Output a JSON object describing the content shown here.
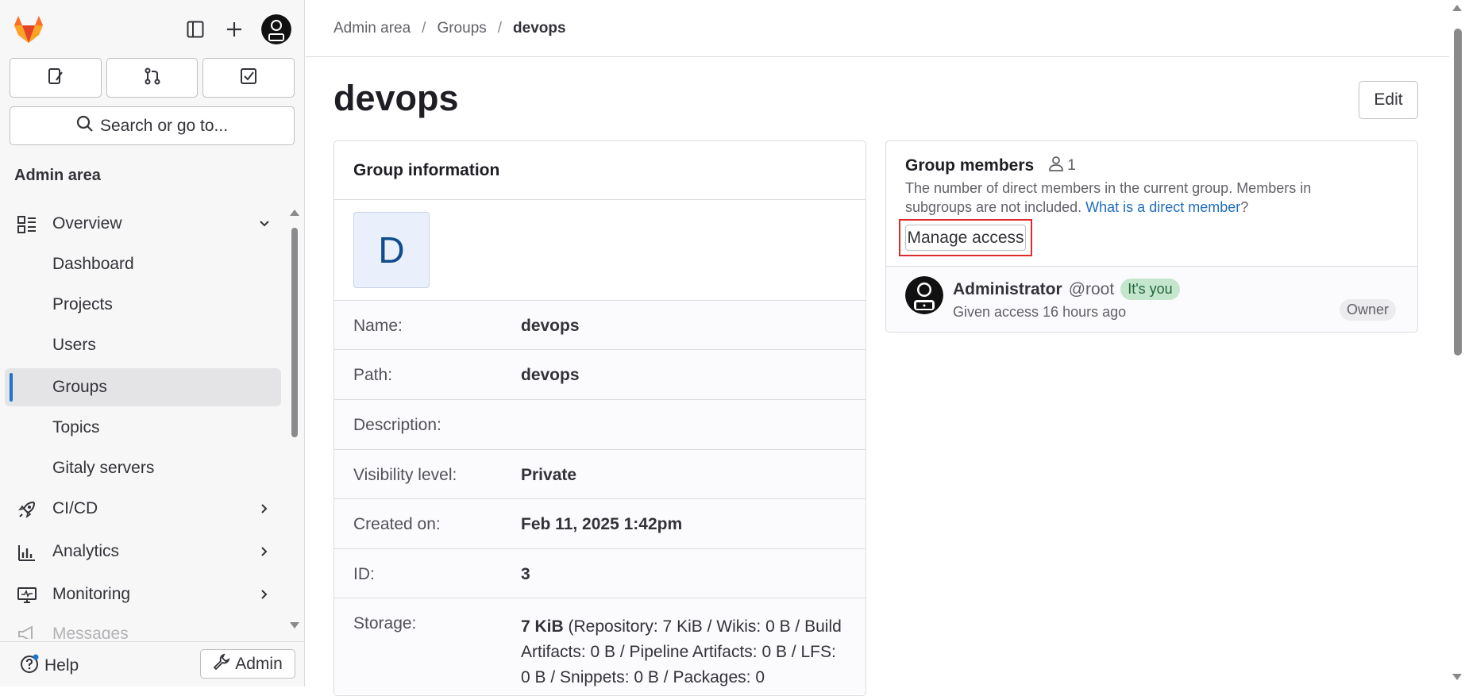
{
  "sidebar": {
    "search_label": "Search or go to...",
    "section_title": "Admin area",
    "items": [
      {
        "label": "Overview",
        "icon": "overview-icon",
        "expanded": true
      },
      {
        "label": "Dashboard"
      },
      {
        "label": "Projects"
      },
      {
        "label": "Users"
      },
      {
        "label": "Groups",
        "active": true
      },
      {
        "label": "Topics"
      },
      {
        "label": "Gitaly servers"
      },
      {
        "label": "CI/CD",
        "icon": "rocket-icon"
      },
      {
        "label": "Analytics",
        "icon": "chart-icon"
      },
      {
        "label": "Monitoring",
        "icon": "monitor-icon"
      },
      {
        "label": "Messages",
        "icon": "bullhorn-icon"
      }
    ],
    "help_label": "Help",
    "admin_label": "Admin"
  },
  "breadcrumb": [
    "Admin area",
    "Groups",
    "devops"
  ],
  "page": {
    "title": "devops",
    "edit_label": "Edit"
  },
  "group_info": {
    "heading": "Group information",
    "avatar_letter": "D",
    "rows": [
      {
        "key": "Name:",
        "value": "devops"
      },
      {
        "key": "Path:",
        "value": "devops"
      },
      {
        "key": "Description:",
        "value": ""
      },
      {
        "key": "Visibility level:",
        "value": "Private"
      },
      {
        "key": "Created on:",
        "value": "Feb 11, 2025 1:42pm"
      },
      {
        "key": "ID:",
        "value": "3"
      },
      {
        "key": "Storage:",
        "value_bold": "7 KiB",
        "value_rest": " (Repository: 7 KiB / Wikis: 0 B / Build Artifacts: 0 B / Pipeline Artifacts: 0 B / LFS: 0 B / Snippets: 0 B / Packages: 0"
      }
    ]
  },
  "members": {
    "heading": "Group members",
    "count": "1",
    "desc": "The number of direct members in the current group. Members in subgroups are not included.",
    "link": "What is a direct member",
    "link_after": "?",
    "manage_label": "Manage access",
    "member": {
      "name": "Administrator",
      "username": "@root",
      "badge": "It's you",
      "given": "Given access 16 hours ago",
      "role": "Owner"
    }
  },
  "colors": {
    "accent": "#1f75cb",
    "link": "#1f6dbd",
    "highlight": "#dd2b2b"
  }
}
